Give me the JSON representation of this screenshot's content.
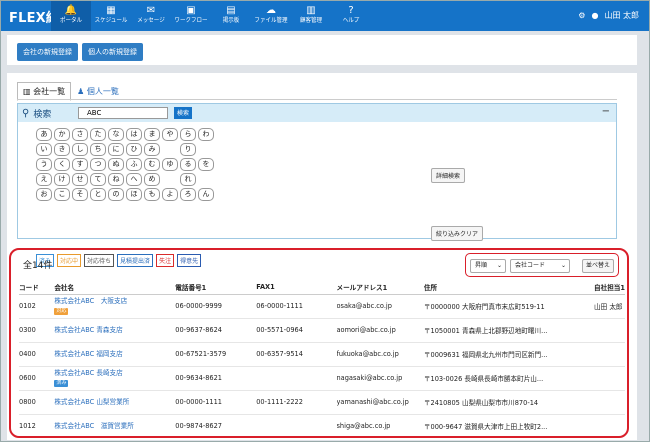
{
  "app": {
    "logo": "FLEX結"
  },
  "nav": [
    {
      "label": "ポータル",
      "icon": "bell-icon",
      "glyph": "🔔"
    },
    {
      "label": "スケジュール",
      "icon": "calendar-icon",
      "glyph": "▦"
    },
    {
      "label": "メッセージ",
      "icon": "envelope-icon",
      "glyph": "✉"
    },
    {
      "label": "ワークフロー",
      "icon": "workflow-icon",
      "glyph": "▣"
    },
    {
      "label": "掲示板",
      "icon": "board-icon",
      "glyph": "▤"
    },
    {
      "label": "ファイル管理",
      "icon": "cloud-icon",
      "glyph": "☁"
    },
    {
      "label": "顧客管理",
      "icon": "building-icon",
      "glyph": "▥"
    },
    {
      "label": "ヘルプ",
      "icon": "help-icon",
      "glyph": "?"
    }
  ],
  "user": {
    "name": "山田 太郎",
    "settings_icon": "gear-icon"
  },
  "register_buttons": [
    "会社の新規登録",
    "個人の新規登録"
  ],
  "tabs": [
    {
      "label": "会社一覧",
      "active": true
    },
    {
      "label": "個人一覧",
      "active": false
    }
  ],
  "search": {
    "title": "検索",
    "value": "ABC",
    "button": "検索",
    "detail_button": "詳細検索",
    "clear_button": "絞り込みクリア",
    "kana_rows": [
      [
        "あ",
        "か",
        "さ",
        "た",
        "な",
        "は",
        "ま",
        "や",
        "ら",
        "わ"
      ],
      [
        "い",
        "き",
        "し",
        "ち",
        "に",
        "ひ",
        "み",
        "",
        "り",
        ""
      ],
      [
        "う",
        "く",
        "す",
        "つ",
        "ぬ",
        "ふ",
        "む",
        "ゆ",
        "る",
        "を"
      ],
      [
        "え",
        "け",
        "せ",
        "て",
        "ね",
        "へ",
        "め",
        "",
        "れ",
        ""
      ],
      [
        "お",
        "こ",
        "そ",
        "と",
        "の",
        "ほ",
        "も",
        "よ",
        "ろ",
        "ん"
      ]
    ],
    "status_tags": [
      {
        "label": "済み",
        "color": "#3a8fd6"
      },
      {
        "label": "対応中",
        "color": "#e89a2c"
      },
      {
        "label": "対応待ち",
        "color": "#555555"
      },
      {
        "label": "見積提出済",
        "color": "#2a6ebc"
      },
      {
        "label": "失注",
        "color": "#d92b2b"
      },
      {
        "label": "得意先",
        "color": "#2a5bb0"
      }
    ]
  },
  "list": {
    "count": "全14件",
    "order_select": "昇順",
    "field_select": "会社コード",
    "sort_button": "並べ替え",
    "columns": [
      "コード",
      "会社名",
      "電話番号1",
      "FAX1",
      "メールアドレス1",
      "住所",
      "自社担当1"
    ],
    "rows": [
      {
        "code": "0102",
        "name": "株式会社ABC　大阪支店",
        "badge": "対応",
        "badge_color": "#f0a03a",
        "tel": "06-0000-9999",
        "fax": "06-0000-1111",
        "mail": "osaka@abc.co.jp",
        "addr": "〒0000000 大阪府門真市末広町519-11",
        "staff": "山田 太郎"
      },
      {
        "code": "0300",
        "name": "株式会社ABC 青森支店",
        "badge": "",
        "badge_color": "",
        "tel": "00-9637-8624",
        "fax": "00-5571-0964",
        "mail": "aomori@abc.co.jp",
        "addr": "〒1050001 青森県上北郡野辺地町曙川...",
        "staff": ""
      },
      {
        "code": "0400",
        "name": "株式会社ABC 福岡支店",
        "badge": "",
        "badge_color": "",
        "tel": "00-67521-3579",
        "fax": "00-6357-9514",
        "mail": "fukuoka@abc.co.jp",
        "addr": "〒0009631 福岡県北九州市門司区新門...",
        "staff": ""
      },
      {
        "code": "0600",
        "name": "株式会社ABC 長崎支店",
        "badge": "済み",
        "badge_color": "#3a8fd6",
        "tel": "00-9634-8621",
        "fax": "",
        "mail": "nagasaki@abc.co.jp",
        "addr": "〒103-0026 長崎県長崎市勝本町片山...",
        "staff": ""
      },
      {
        "code": "0800",
        "name": "株式会社ABC 山梨営業所",
        "badge": "",
        "badge_color": "",
        "tel": "00-0000-1111",
        "fax": "00-1111-2222",
        "mail": "yamanashi@abc.co.jp",
        "addr": "〒2410805 山梨県山梨市市川870-14",
        "staff": ""
      },
      {
        "code": "1012",
        "name": "株式会社ABC　滋賀営業所",
        "badge": "",
        "badge_color": "",
        "tel": "00-9874-8627",
        "fax": "",
        "mail": "shiga@abc.co.jp",
        "addr": "〒000-9647 滋賀県大津市上田上牧町2...",
        "staff": ""
      }
    ]
  }
}
